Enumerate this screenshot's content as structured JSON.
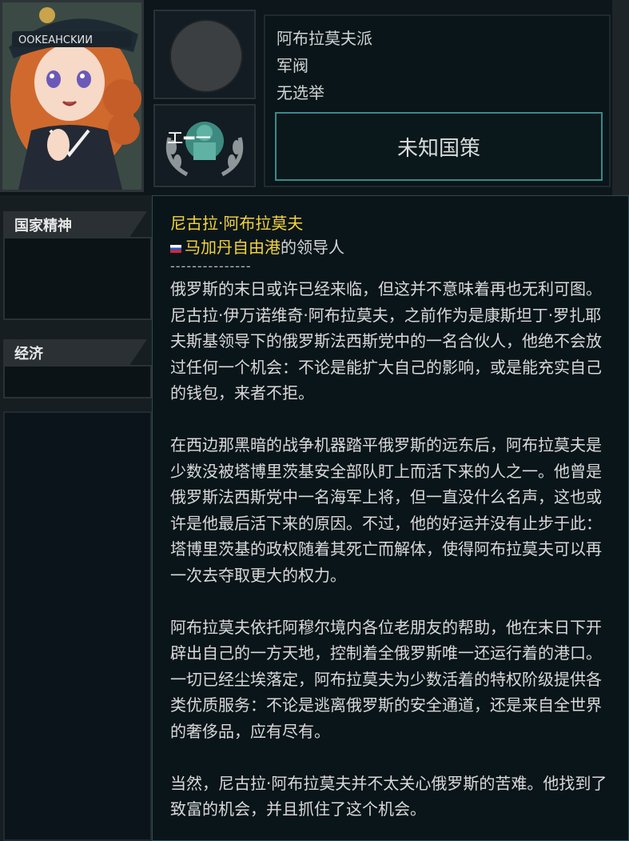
{
  "header": {
    "party_name": "阿布拉莫夫派",
    "ideology": "军阀",
    "election": "无选举",
    "policy_label": "未知国策"
  },
  "portrait": {
    "cap_text": "OOKEAHCKИИ"
  },
  "ideology_badge": {
    "text": "エ━ー"
  },
  "sidebar": {
    "sections": [
      {
        "label": "国家精神"
      },
      {
        "label": "经济"
      }
    ]
  },
  "tooltip": {
    "leader_name": "尼古拉·阿布拉莫夫",
    "country": "马加丹自由港",
    "role_suffix": "的领导人",
    "separator": "---------------",
    "paragraphs": [
      "俄罗斯的末日或许已经来临，但这并不意味着再也无利可图。尼古拉·伊万诺维奇·阿布拉莫夫，之前作为是康斯坦丁·罗扎耶夫斯基领导下的俄罗斯法西斯党中的一名合伙人，他绝不会放过任何一个机会：不论是能扩大自己的影响，或是能充实自己的钱包，来者不拒。",
      "在西边那黑暗的战争机器踏平俄罗斯的远东后，阿布拉莫夫是少数没被塔博里茨基安全部队盯上而活下来的人之一。他曾是俄罗斯法西斯党中一名海军上将，但一直没什么名声，这也或许是他最后活下来的原因。不过，他的好运并没有止步于此：塔博里茨基的政权随着其死亡而解体，使得阿布拉莫夫可以再一次去夺取更大的权力。",
      "阿布拉莫夫依托阿穆尔境内各位老朋友的帮助，他在末日下开辟出自己的一方天地，控制着全俄罗斯唯一还运行着的港口。一切已经尘埃落定，阿布拉莫夫为少数活着的特权阶级提供各类优质服务：不论是逃离俄罗斯的安全通道，还是来自全世界的奢侈品，应有尽有。",
      "当然，尼古拉·阿布拉莫夫并不太关心俄罗斯的苦难。他找到了致富的机会，并且抓住了这个机会。"
    ]
  },
  "colors": {
    "tooltip_title": "#f2d43a",
    "policy_border": "#3a8a8a",
    "background": "#0d161b"
  }
}
